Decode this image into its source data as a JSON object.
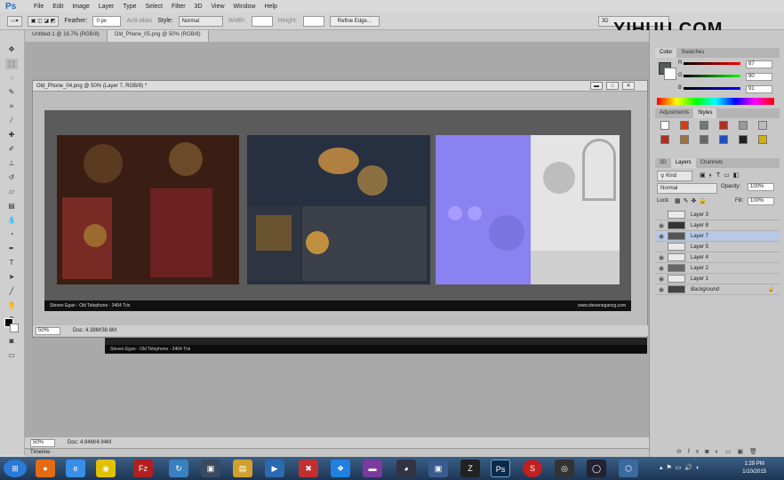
{
  "menu": {
    "items": [
      "File",
      "Edit",
      "Image",
      "Layer",
      "Type",
      "Select",
      "Filter",
      "3D",
      "View",
      "Window",
      "Help"
    ]
  },
  "options": {
    "feather_label": "Feather:",
    "feather_value": "0 px",
    "antialias_label": "Anti-alias",
    "style_label": "Style:",
    "style_value": "Normal",
    "width_label": "Width:",
    "height_label": "Height:",
    "refine_label": "Refine Edge...",
    "workspace_value": "3D"
  },
  "watermark": "YIHUU.COM",
  "doc_tabs": [
    "Untitled-1 @ 16.7% (RGB/8)",
    "Old_Phone_05.png @ 50% (RGB/8)"
  ],
  "doc_window": {
    "title": "Old_Phone_04.png @ 50% (Layer 7, RGB/8) *"
  },
  "credit": {
    "left": "Steven Egan - Old Telephone - 3464 Tris",
    "right": "www.stevenegancg.com"
  },
  "status": {
    "zoom": "50%",
    "doc": "Doc: 4.38M/38.6M"
  },
  "status2": {
    "zoom": "50%",
    "doc": "Doc: 4.94M/4.94M"
  },
  "timeline": "Timeline",
  "color_panel": {
    "tabs": [
      "Color",
      "Swatches"
    ],
    "r_label": "R",
    "g_label": "G",
    "b_label": "B",
    "r": "87",
    "g": "90",
    "b": "91"
  },
  "adj_panel": {
    "tabs": [
      "Adjustments",
      "Styles"
    ]
  },
  "layers_panel": {
    "tabs": [
      "3D",
      "Layers",
      "Channels"
    ],
    "kind_label": "Kind",
    "blend": "Normal",
    "opacity_label": "Opacity:",
    "opacity": "100%",
    "lock_label": "Lock:",
    "fill_label": "Fill:",
    "fill": "100%",
    "layers": [
      "Layer 3",
      "Layer 8",
      "Layer 7",
      "Layer 5",
      "Layer 4",
      "Layer 2",
      "Layer 1",
      "Background"
    ]
  },
  "taskbar": {
    "time": "1:29 PM",
    "date": "1/10/2015"
  }
}
